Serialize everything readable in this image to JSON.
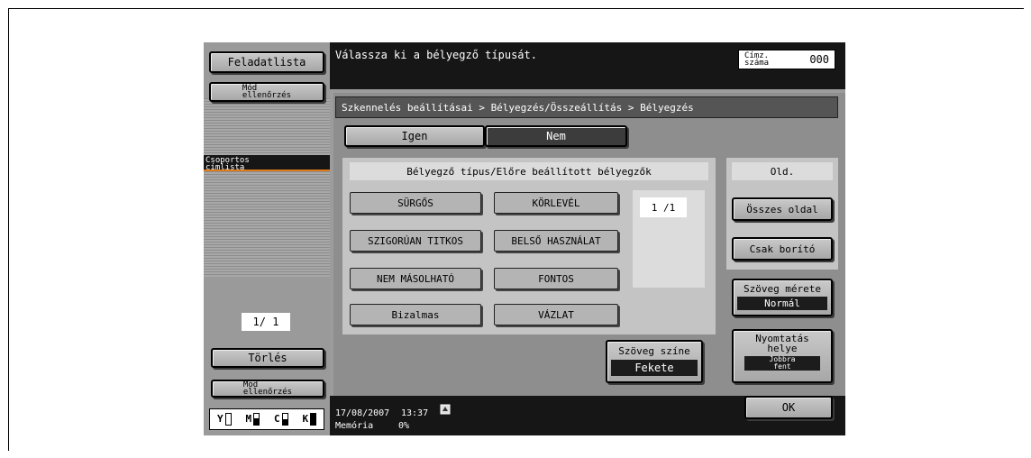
{
  "left_panel": {
    "job_list_button": "Feladatlista",
    "mode_check_top": "Mód\nellenőrzés",
    "group_address_label": "Csoportos\ncímlista",
    "page_indicator": "1/ 1",
    "delete_button": "Törlés",
    "mode_check_bottom": "Mód\nellenőrzés",
    "toner": [
      "Y",
      "M",
      "C",
      "K"
    ]
  },
  "header": {
    "instruction": "Válassza ki a bélyegző típusát.",
    "address_count_label": "Címz.\nszáma",
    "address_count_value": "000"
  },
  "breadcrumb": "Szkennelés beállításai > Bélyegzés/Összeállítás > Bélyegzés",
  "toggle": {
    "yes": "Igen",
    "no": "Nem"
  },
  "stamp_panel": {
    "title": "Bélyegző típus/Előre beállított bélyegzők",
    "stamps": [
      "SÜRGŐS",
      "KÖRLEVÉL",
      "SZIGORÚAN TITKOS",
      "BELSŐ HASZNÁLAT",
      "NEM MÁSOLHATÓ",
      "FONTOS",
      "Bizalmas",
      "VÁZLAT"
    ],
    "page": "1  /1"
  },
  "text_color": {
    "label": "Szöveg színe",
    "value": "Fekete"
  },
  "pages_panel": {
    "title": "Old.",
    "all_pages": "Összes oldal",
    "cover_only": "Csak borító"
  },
  "text_size": {
    "label": "Szöveg mérete",
    "value": "Normál"
  },
  "print_position": {
    "label": "Nyomtatás\nhelye",
    "value": "Jobbra\nfent"
  },
  "status": {
    "date": "17/08/2007",
    "time": "13:37",
    "memory_label": "Memória",
    "memory_value": "0%"
  },
  "ok_button": "OK"
}
